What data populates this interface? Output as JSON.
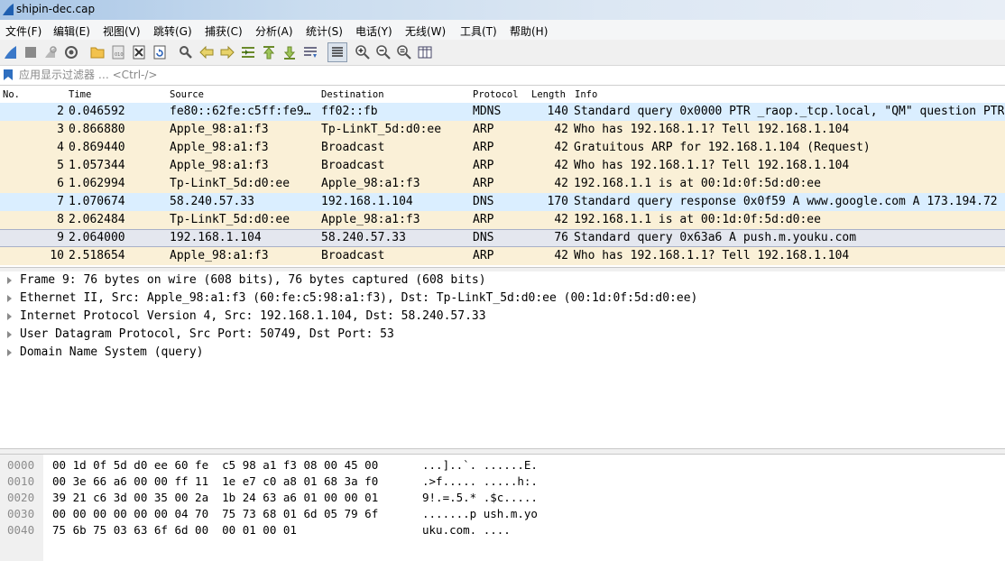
{
  "window": {
    "title": "shipin-dec.cap"
  },
  "menu": [
    "文件(F)",
    "编辑(E)",
    "视图(V)",
    "跳转(G)",
    "捕获(C)",
    "分析(A)",
    "统计(S)",
    "电话(Y)",
    "无线(W)",
    "工具(T)",
    "帮助(H)"
  ],
  "toolbar": {
    "icons": [
      "start-capture-icon",
      "stop-capture-icon",
      "restart-capture-icon",
      "capture-options-icon",
      "open-file-icon",
      "save-file-icon",
      "close-file-icon",
      "reload-file-icon",
      "find-packet-icon",
      "go-back-icon",
      "go-forward-icon",
      "go-to-packet-icon",
      "go-first-icon",
      "go-last-icon",
      "auto-scroll-icon",
      "colorize-icon",
      "zoom-in-icon",
      "zoom-out-icon",
      "zoom-normal-icon",
      "resize-columns-icon"
    ]
  },
  "filter": {
    "placeholder": "应用显示过滤器 … <Ctrl-/>"
  },
  "columns": {
    "no": "No.",
    "time": "Time",
    "source": "Source",
    "destination": "Destination",
    "protocol": "Protocol",
    "length": "Length",
    "info": "Info"
  },
  "colors": {
    "arp": "#faf0d7",
    "mdns": "#daeeff",
    "dns": "#daeeff",
    "selected": "#e4e7ef",
    "selected_border": "#a8b0c8"
  },
  "packets": [
    {
      "no": "2",
      "time": "0.046592",
      "source": "fe80::62fe:c5ff:fe9…",
      "destination": "ff02::fb",
      "protocol": "MDNS",
      "length": "140",
      "info": "Standard query 0x0000 PTR _raop._tcp.local, \"QM\" question PTR",
      "color": "mdns"
    },
    {
      "no": "3",
      "time": "0.866880",
      "source": "Apple_98:a1:f3",
      "destination": "Tp-LinkT_5d:d0:ee",
      "protocol": "ARP",
      "length": "42",
      "info": "Who has 192.168.1.1? Tell 192.168.1.104",
      "color": "arp"
    },
    {
      "no": "4",
      "time": "0.869440",
      "source": "Apple_98:a1:f3",
      "destination": "Broadcast",
      "protocol": "ARP",
      "length": "42",
      "info": "Gratuitous ARP for 192.168.1.104 (Request)",
      "color": "arp"
    },
    {
      "no": "5",
      "time": "1.057344",
      "source": "Apple_98:a1:f3",
      "destination": "Broadcast",
      "protocol": "ARP",
      "length": "42",
      "info": "Who has 192.168.1.1? Tell 192.168.1.104",
      "color": "arp"
    },
    {
      "no": "6",
      "time": "1.062994",
      "source": "Tp-LinkT_5d:d0:ee",
      "destination": "Apple_98:a1:f3",
      "protocol": "ARP",
      "length": "42",
      "info": "192.168.1.1 is at 00:1d:0f:5d:d0:ee",
      "color": "arp"
    },
    {
      "no": "7",
      "time": "1.070674",
      "source": "58.240.57.33",
      "destination": "192.168.1.104",
      "protocol": "DNS",
      "length": "170",
      "info": "Standard query response 0x0f59 A www.google.com A 173.194.72",
      "color": "dns"
    },
    {
      "no": "8",
      "time": "2.062484",
      "source": "Tp-LinkT_5d:d0:ee",
      "destination": "Apple_98:a1:f3",
      "protocol": "ARP",
      "length": "42",
      "info": "192.168.1.1 is at 00:1d:0f:5d:d0:ee",
      "color": "arp"
    },
    {
      "no": "9",
      "time": "2.064000",
      "source": "192.168.1.104",
      "destination": "58.240.57.33",
      "protocol": "DNS",
      "length": "76",
      "info": "Standard query 0x63a6 A push.m.youku.com",
      "color": "selected"
    },
    {
      "no": "10",
      "time": "2.518654",
      "source": "Apple_98:a1:f3",
      "destination": "Broadcast",
      "protocol": "ARP",
      "length": "42",
      "info": "Who has 192.168.1.1? Tell 192.168.1.104",
      "color": "arp"
    }
  ],
  "details": [
    "Frame 9: 76 bytes on wire (608 bits), 76 bytes captured (608 bits)",
    "Ethernet II, Src: Apple_98:a1:f3 (60:fe:c5:98:a1:f3), Dst: Tp-LinkT_5d:d0:ee (00:1d:0f:5d:d0:ee)",
    "Internet Protocol Version 4, Src: 192.168.1.104, Dst: 58.240.57.33",
    "User Datagram Protocol, Src Port: 50749, Dst Port: 53",
    "Domain Name System (query)"
  ],
  "bytes": [
    {
      "offset": "0000",
      "hex": "00 1d 0f 5d d0 ee 60 fe  c5 98 a1 f3 08 00 45 00",
      "ascii": "...]..`. ......E."
    },
    {
      "offset": "0010",
      "hex": "00 3e 66 a6 00 00 ff 11  1e e7 c0 a8 01 68 3a f0",
      "ascii": ".>f..... .....h:."
    },
    {
      "offset": "0020",
      "hex": "39 21 c6 3d 00 35 00 2a  1b 24 63 a6 01 00 00 01",
      "ascii": "9!.=.5.* .$c....."
    },
    {
      "offset": "0030",
      "hex": "00 00 00 00 00 00 04 70  75 73 68 01 6d 05 79 6f",
      "ascii": ".......p ush.m.yo"
    },
    {
      "offset": "0040",
      "hex": "75 6b 75 03 63 6f 6d 00  00 01 00 01",
      "ascii": "uku.com. ...."
    }
  ]
}
